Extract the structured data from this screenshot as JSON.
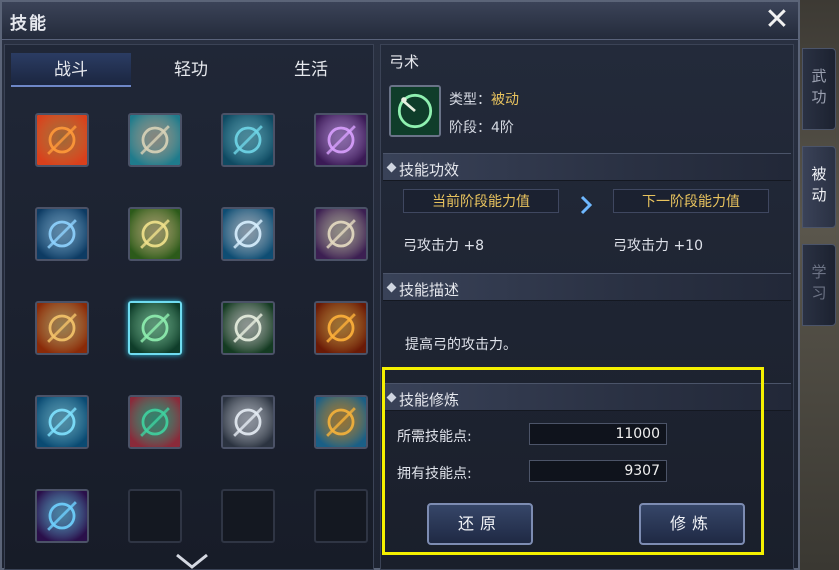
{
  "window": {
    "title": "技能",
    "close_label": "✕"
  },
  "tabs": [
    {
      "label": "战斗",
      "active": true
    },
    {
      "label": "轻功",
      "active": false
    },
    {
      "label": "生活",
      "active": false
    }
  ],
  "side_tabs": [
    {
      "label": "武功",
      "state": "normal"
    },
    {
      "label": "被动",
      "state": "active"
    },
    {
      "label": "学习",
      "state": "dim"
    }
  ],
  "skill_icons": [
    {
      "name": "flame-wall-icon",
      "colors": [
        "#d9401c",
        "#ff9a3a"
      ]
    },
    {
      "name": "turtle-shell-icon",
      "colors": [
        "#1f7b8c",
        "#d9d3b8"
      ]
    },
    {
      "name": "claw-strike-icon",
      "colors": [
        "#0f4a62",
        "#6fd6e8"
      ]
    },
    {
      "name": "purple-shield-icon",
      "colors": [
        "#3a1a55",
        "#d9a0ff"
      ]
    },
    {
      "name": "spirit-aura-icon",
      "colors": [
        "#0d3b63",
        "#8fd3ff"
      ]
    },
    {
      "name": "golden-blade-icon",
      "colors": [
        "#2c5a1a",
        "#f2e28c"
      ]
    },
    {
      "name": "wind-slash-icon",
      "colors": [
        "#0e4d73",
        "#d8f0ff"
      ]
    },
    {
      "name": "violet-blade-icon",
      "colors": [
        "#3c1f52",
        "#e6dbc2"
      ]
    },
    {
      "name": "fire-sword-icon",
      "colors": [
        "#8a2a08",
        "#f5c46a"
      ]
    },
    {
      "name": "bow-ring-icon",
      "colors": [
        "#0f3d2a",
        "#8ff0b0"
      ]
    },
    {
      "name": "shuriken-icon",
      "colors": [
        "#143b22",
        "#e8efe0"
      ]
    },
    {
      "name": "inferno-icon",
      "colors": [
        "#6a1a06",
        "#ffb13a"
      ]
    },
    {
      "name": "wave-icon",
      "colors": [
        "#0a4a72",
        "#7fe2ff"
      ]
    },
    {
      "name": "jade-dragon-icon",
      "colors": [
        "#8a2a3a",
        "#3fd3a0"
      ]
    },
    {
      "name": "blade-rain-icon",
      "colors": [
        "#2b3340",
        "#e6ecf4"
      ]
    },
    {
      "name": "mountain-flame-icon",
      "colors": [
        "#1a5f86",
        "#f6b23a"
      ]
    },
    {
      "name": "vortex-icon",
      "colors": [
        "#2a0f4a",
        "#6fd1ff"
      ]
    },
    {
      "name": "empty-slot",
      "colors": []
    },
    {
      "name": "empty-slot",
      "colors": []
    },
    {
      "name": "empty-slot",
      "colors": []
    }
  ],
  "detail": {
    "skill_name": "弓术",
    "type_label": "类型：",
    "type_value": "被动",
    "stage_label": "阶段：",
    "stage_value": "4阶",
    "effect_section": "技能功效",
    "current_header": "当前阶段能力值",
    "next_header": "下一阶段能力值",
    "current_value": "弓攻击力 +8",
    "next_value": "弓攻击力 +10",
    "desc_section": "技能描述",
    "description": "提高弓的攻击力。",
    "train_section": "技能修炼",
    "required_label": "所需技能点:",
    "required_value": "11000",
    "owned_label": "拥有技能点:",
    "owned_value": "9307",
    "reset_button": "还原",
    "train_button": "修炼"
  },
  "colors": {
    "accent_gold": "#e8c35e",
    "highlight": "#f5f000",
    "selected_glow": "#6fdcf0"
  }
}
